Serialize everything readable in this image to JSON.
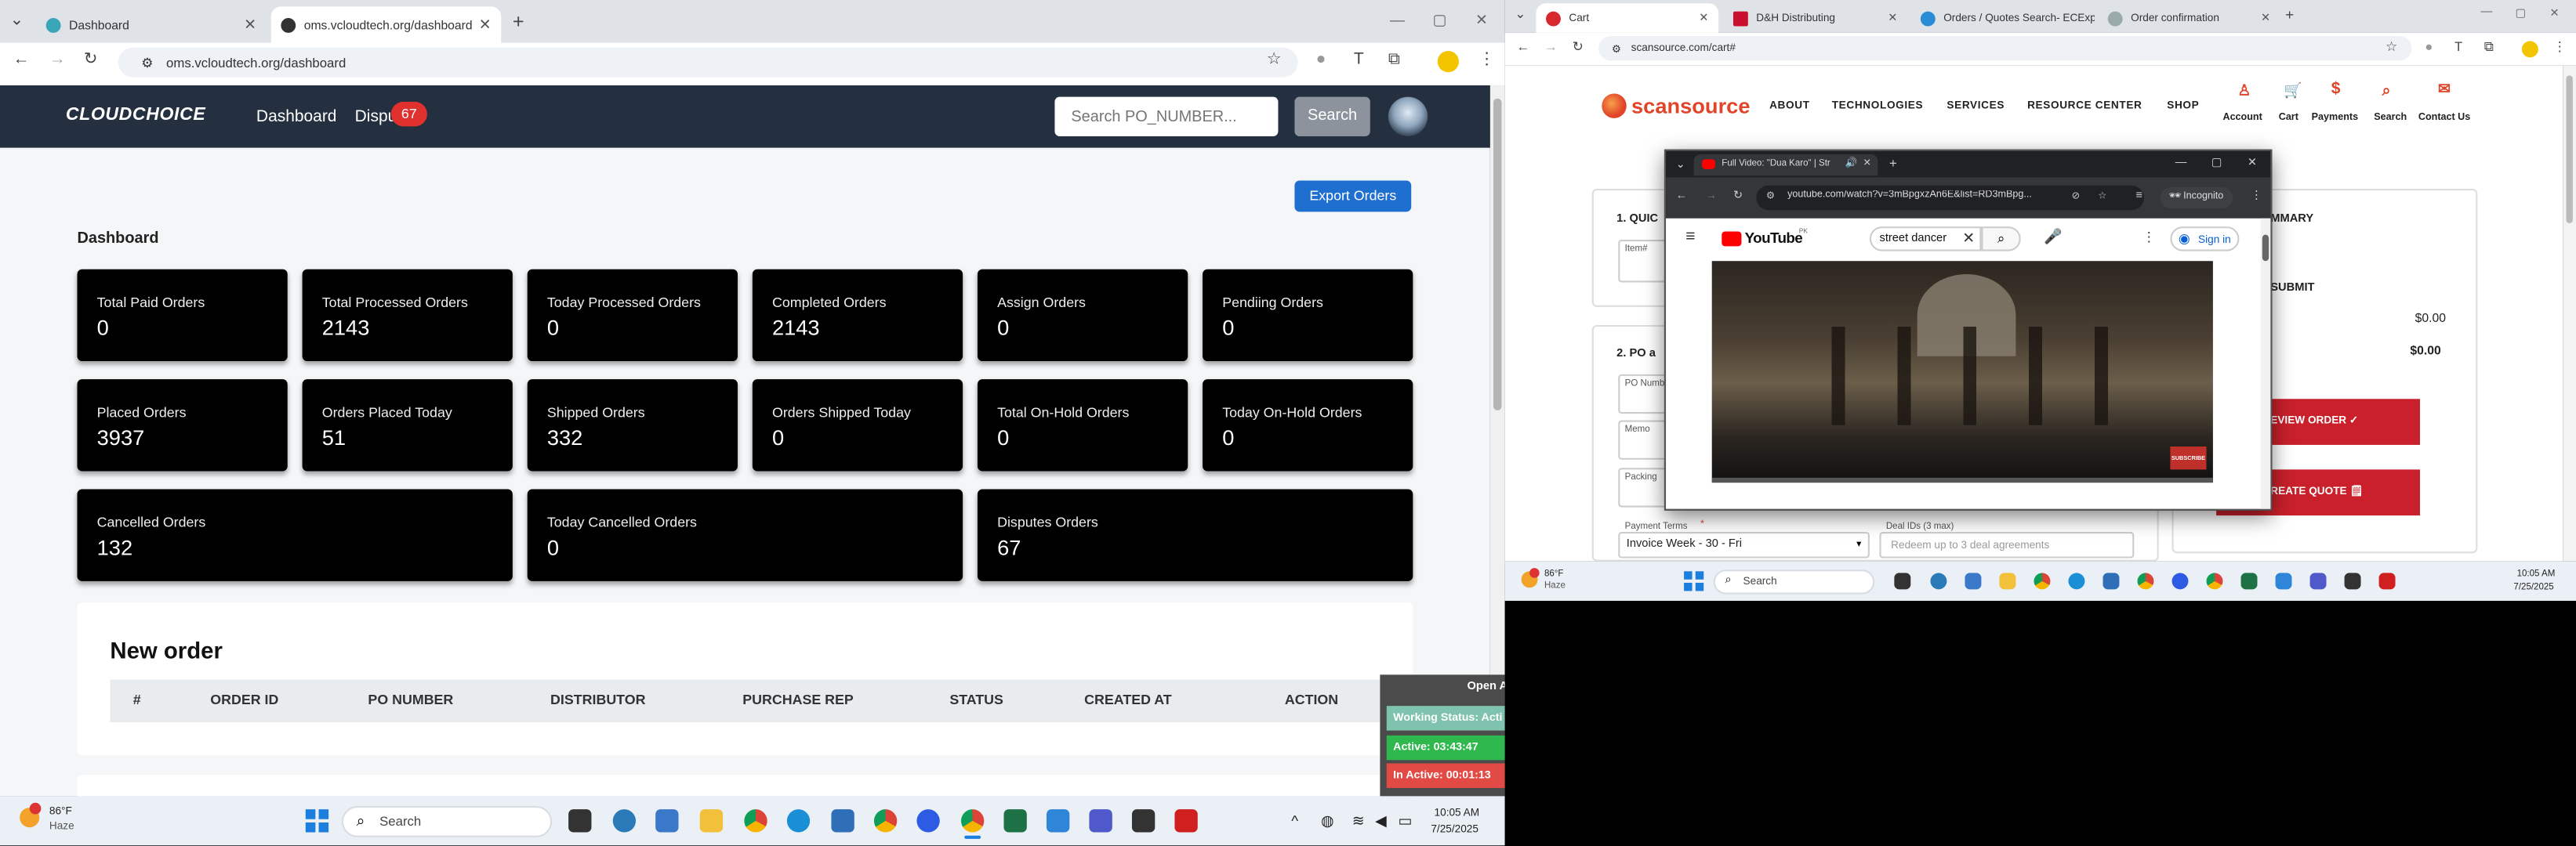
{
  "left_browser": {
    "tabs": [
      {
        "label": "Dashboard",
        "active": false
      },
      {
        "label": "oms.vcloudtech.org/dashboard",
        "active": true
      }
    ],
    "url": "oms.vcloudtech.org/dashboard"
  },
  "app": {
    "logo": "CLOUDCHOICE",
    "nav_dashboard": "Dashboard",
    "nav_disputes": "Dispu",
    "disputes_badge": "67",
    "search_placeholder": "Search PO_NUMBER...",
    "search_button": "Search",
    "export_button": "Export Orders",
    "section_title": "Dashboard",
    "cards": [
      {
        "title": "Total Paid Orders",
        "value": "0"
      },
      {
        "title": "Total Processed Orders",
        "value": "2143"
      },
      {
        "title": "Today Processed Orders",
        "value": "0"
      },
      {
        "title": "Completed Orders",
        "value": "2143"
      },
      {
        "title": "Assign Orders",
        "value": "0"
      },
      {
        "title": "Pendiing Orders",
        "value": "0"
      },
      {
        "title": "Placed Orders",
        "value": "3937"
      },
      {
        "title": "Orders Placed Today",
        "value": "51"
      },
      {
        "title": "Shipped Orders",
        "value": "332"
      },
      {
        "title": "Orders Shipped Today",
        "value": "0"
      },
      {
        "title": "Total On-Hold Orders",
        "value": "0"
      },
      {
        "title": "Today On-Hold Orders",
        "value": "0"
      },
      {
        "title": "Cancelled Orders",
        "value": "132"
      },
      {
        "title": "Today Cancelled Orders",
        "value": "0"
      },
      {
        "title": "Disputes Orders",
        "value": "67"
      }
    ],
    "new_order_title": "New order",
    "table_headers": [
      "#",
      "ORDER ID",
      "PO NUMBER",
      "DISTRIBUTOR",
      "PURCHASE REP",
      "STATUS",
      "CREATED AT",
      "ACTION"
    ],
    "status_panel": {
      "open": "Open A",
      "working": "Working Status: Acti",
      "active": "Active: 03:43:47",
      "inactive": "In Active: 00:01:13"
    }
  },
  "taskbar_left": {
    "weather_temp": "86°F",
    "weather_cond": "Haze",
    "search": "Search",
    "time": "10:05 AM",
    "date": "7/25/2025"
  },
  "right_browser": {
    "tabs": [
      {
        "label": "Cart",
        "active": true
      },
      {
        "label": "D&H Distributing",
        "active": false
      },
      {
        "label": "Orders / Quotes Search- ECExp",
        "active": false
      },
      {
        "label": "Order confirmation",
        "active": false
      }
    ],
    "url": "scansource.com/cart#"
  },
  "scansource": {
    "logo": "scansource",
    "nav": [
      "ABOUT",
      "TECHNOLOGIES",
      "SERVICES",
      "RESOURCE CENTER",
      "SHOP"
    ],
    "icons": [
      "Account",
      "Cart",
      "Payments",
      "Search",
      "Contact Us"
    ],
    "step1": "1. QUIC",
    "item_label": "Item#",
    "step2": "2. PO a",
    "po_label": "PO Numb",
    "memo_label": "Memo",
    "packing_label": "Packing",
    "payment_terms_label": "Payment Terms",
    "payment_terms_value": "Invoice Week - 30 - Fri",
    "deal_label": "Deal IDs (3 max)",
    "deal_placeholder": "Redeem up to 3 deal agreements",
    "summary": "MMARY",
    "submit": "SUBMIT",
    "amount1": "$0.00",
    "amount2": "$0.00",
    "review_btn": "EVIEW ORDER ✓",
    "quote_btn": "REATE QUOTE 🗒"
  },
  "popup": {
    "tab": "Full Video: \"Dua Karo\" | Str",
    "url": "youtube.com/watch?v=3mBpgxzAn6E&list=RD3mBpg...",
    "incognito": "Incognito",
    "yt_logo": "YouTube",
    "yt_country": "PK",
    "yt_search": "street dancer",
    "signin": "Sign in",
    "subscribe": "SUBSCRIBE"
  },
  "taskbar_right": {
    "weather_temp": "86°F",
    "weather_cond": "Haze",
    "search": "Search",
    "time": "10:05 AM",
    "date": "7/25/2025"
  }
}
